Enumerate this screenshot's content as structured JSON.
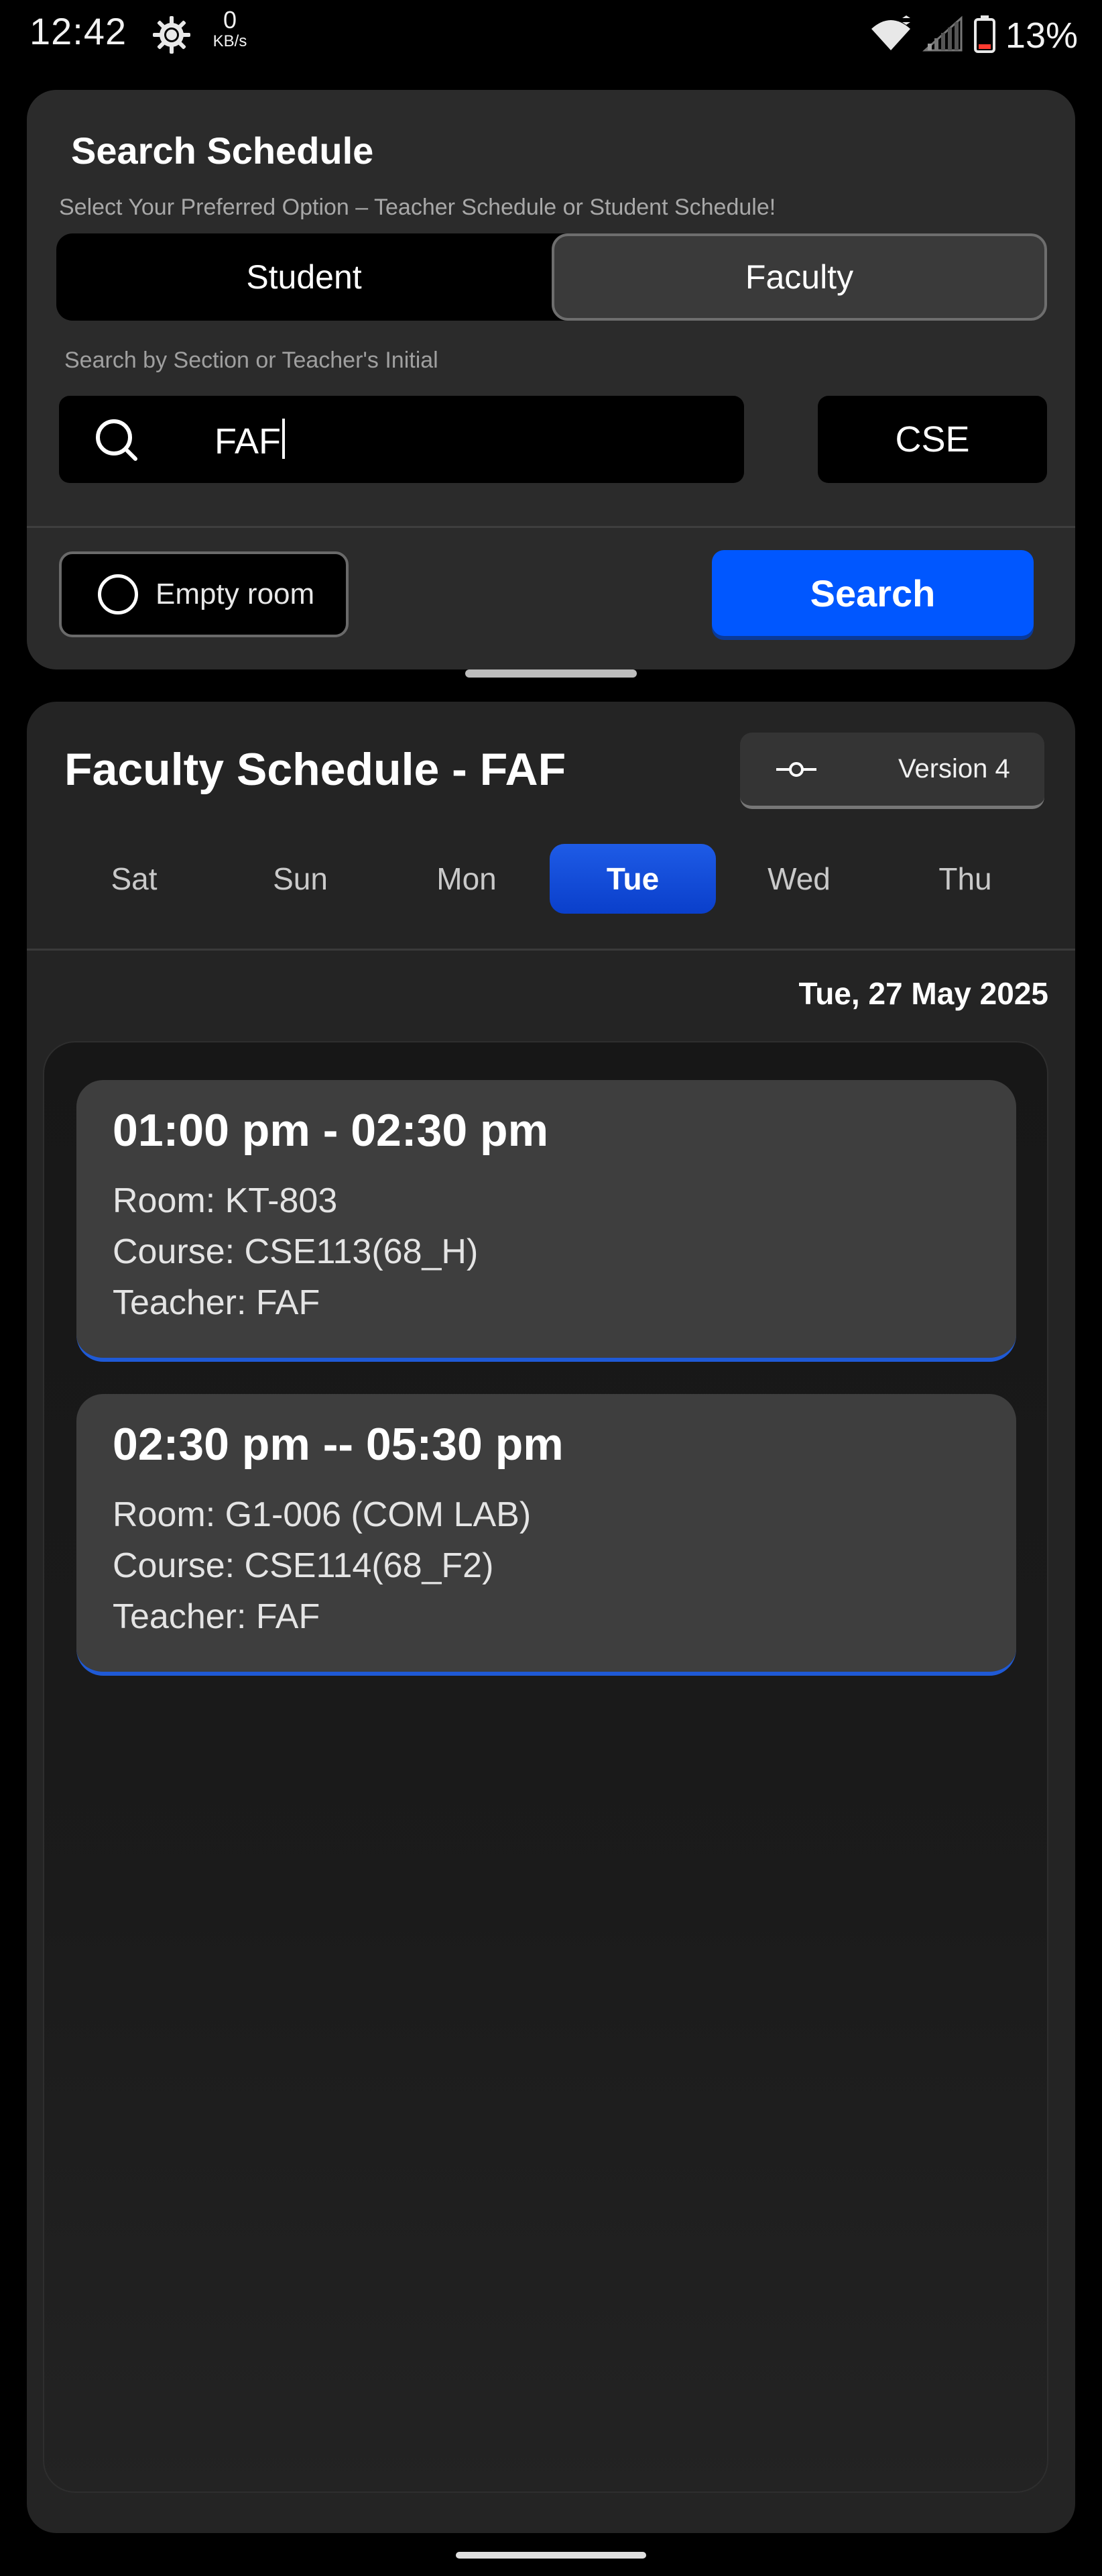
{
  "status_bar": {
    "time": "12:42",
    "net_speed_value": "0",
    "net_speed_unit": "KB/s",
    "battery_percent": "13%",
    "icons": [
      "settings-gear-icon",
      "wifi-icon",
      "cell-signal-icon",
      "battery-icon"
    ]
  },
  "search_panel": {
    "title": "Search Schedule",
    "subtitle": "Select Your Preferred Option – Teacher Schedule or Student Schedule!",
    "tabs": [
      {
        "label": "Student",
        "selected": false
      },
      {
        "label": "Faculty",
        "selected": true
      }
    ],
    "hint": "Search by Section or Teacher's Initial",
    "query_value": "FAF",
    "department": "CSE",
    "empty_room_label": "Empty room",
    "empty_room_checked": false,
    "search_button_label": "Search"
  },
  "schedule": {
    "title": "Faculty Schedule - FAF",
    "version_label": "Version 4",
    "days": [
      {
        "label": "Sat",
        "active": false
      },
      {
        "label": "Sun",
        "active": false
      },
      {
        "label": "Mon",
        "active": false
      },
      {
        "label": "Tue",
        "active": true
      },
      {
        "label": "Wed",
        "active": false
      },
      {
        "label": "Thu",
        "active": false
      }
    ],
    "date_label": "Tue, 27 May 2025",
    "classes": [
      {
        "time": "01:00 pm - 02:30 pm",
        "room": "Room: KT-803",
        "course": "Course: CSE113(68_H)",
        "teacher": "Teacher: FAF"
      },
      {
        "time": "02:30 pm -- 05:30 pm",
        "room": "Room: G1-006 (COM LAB)",
        "course": "Course: CSE114(68_F2)",
        "teacher": "Teacher: FAF"
      }
    ]
  },
  "colors": {
    "accent_blue": "#0057ff",
    "active_day_blue": "#1e5be6",
    "card_bg": "#2b2b2b",
    "class_card_bg": "#3e3e3e"
  }
}
